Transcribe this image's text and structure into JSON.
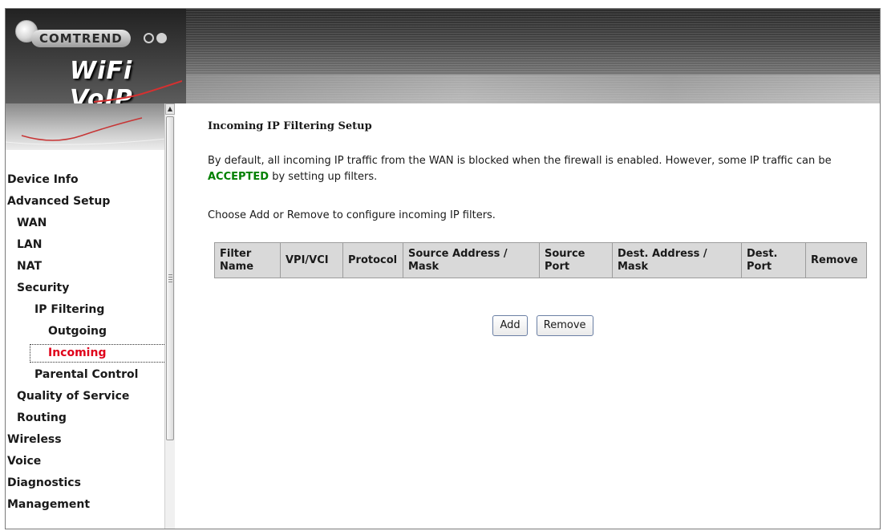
{
  "header": {
    "brand": "COMTREND",
    "product": "WiFi VoIP GW"
  },
  "sidebar": {
    "items": [
      {
        "label": "Device Info"
      },
      {
        "label": "Advanced Setup"
      },
      {
        "label": "WAN"
      },
      {
        "label": "LAN"
      },
      {
        "label": "NAT"
      },
      {
        "label": "Security"
      },
      {
        "label": "IP Filtering"
      },
      {
        "label": "Outgoing"
      },
      {
        "label": "Incoming"
      },
      {
        "label": "Parental Control"
      },
      {
        "label": "Quality of Service"
      },
      {
        "label": "Routing"
      },
      {
        "label": "Wireless"
      },
      {
        "label": "Voice"
      },
      {
        "label": "Diagnostics"
      },
      {
        "label": "Management"
      }
    ],
    "active_item": "Incoming"
  },
  "main": {
    "title": "Incoming IP Filtering Setup",
    "intro_part1": "By default, all incoming IP traffic from the WAN is blocked when the firewall is enabled. However, some IP traffic can be ",
    "intro_highlight": "ACCEPTED",
    "intro_part2": " by setting up filters.",
    "instruction": "Choose Add or Remove to configure incoming IP filters.",
    "table": {
      "headers": [
        {
          "l1": "Filter",
          "l2": "Name"
        },
        {
          "l1": "VPI/VCI",
          "l2": ""
        },
        {
          "l1": "Protocol",
          "l2": ""
        },
        {
          "l1": "Source Address /",
          "l2": "Mask"
        },
        {
          "l1": "Source",
          "l2": "Port"
        },
        {
          "l1": "Dest. Address /",
          "l2": "Mask"
        },
        {
          "l1": "Dest.",
          "l2": "Port"
        },
        {
          "l1": "Remove",
          "l2": ""
        }
      ],
      "rows": []
    },
    "buttons": {
      "add": "Add",
      "remove": "Remove"
    }
  },
  "colors": {
    "accent_active": "#e0001a",
    "accepted": "#008000",
    "table_header_bg": "#d9d9d9"
  }
}
